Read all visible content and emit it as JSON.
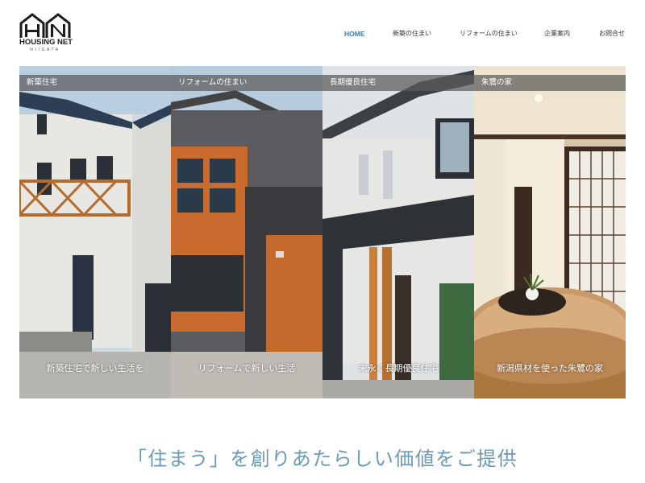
{
  "logo": {
    "title": "HOUSING NET",
    "subtitle": "NIIGATA",
    "icon": "house-logo-icon"
  },
  "nav": {
    "items": [
      {
        "label": "HOME",
        "active": true
      },
      {
        "label": "新築の住まい",
        "active": false
      },
      {
        "label": "リフォームの住まい",
        "active": false
      },
      {
        "label": "企業案内",
        "active": false
      },
      {
        "label": "お問合せ",
        "active": false
      }
    ]
  },
  "panels": [
    {
      "tag": "新築住宅",
      "caption": "新築住宅で新しい生活を"
    },
    {
      "tag": "リフォームの住まい",
      "caption": "リフォームで新しい生活"
    },
    {
      "tag": "長期優良住宅",
      "caption": "末永く長期優良住宅"
    },
    {
      "tag": "朱鷺の家",
      "caption": "新潟県材を使った朱鷺の家"
    }
  ],
  "tagline": "「住まう」を創りあたらしい価値をご提供",
  "colors": {
    "accent": "#3a7bb0",
    "tagline": "#6a9ab8",
    "tag_bg": "#5a5a5a"
  }
}
